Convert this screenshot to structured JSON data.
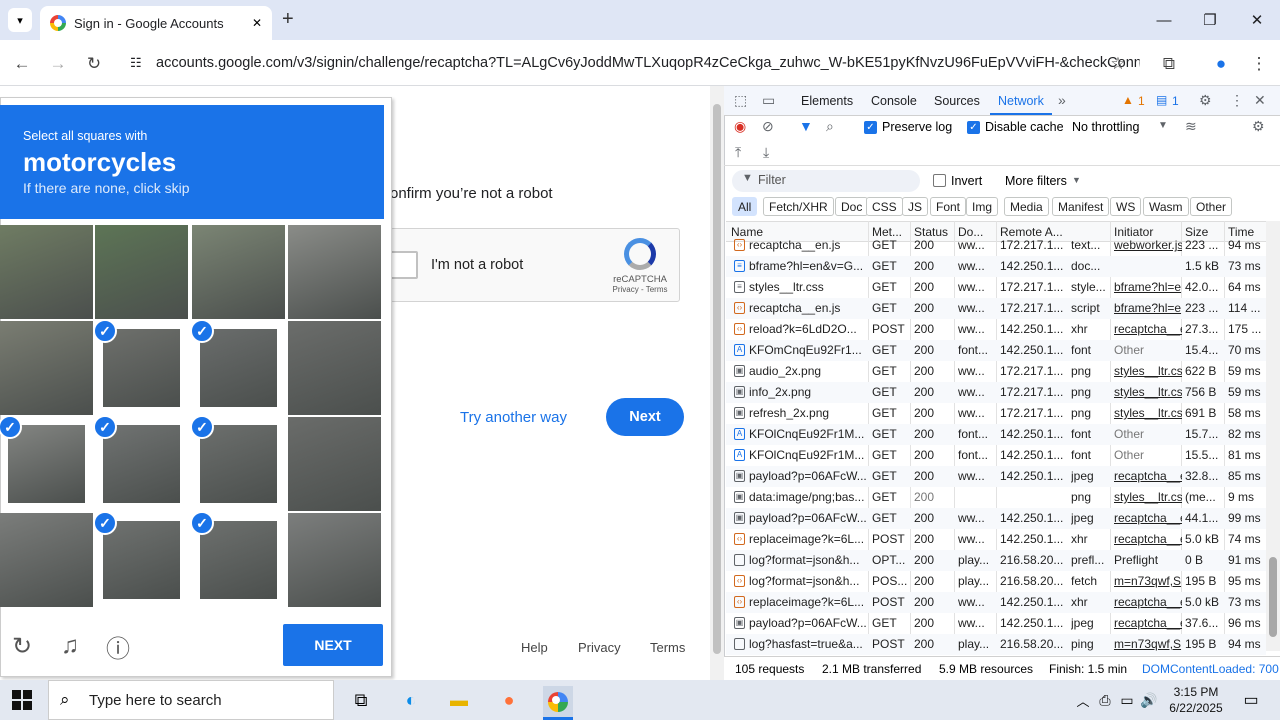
{
  "browser": {
    "tab_title": "Sign in - Google Accounts",
    "url": "accounts.google.com/v3/signin/challenge/recaptcha?TL=ALgCv6yJoddMwTLXuqopR4zCeCkga_zuhwc_W-bKE51pyKfNvzU96FuEpVVviFH-&checkConn...",
    "new_tab": "+",
    "minimize": "—",
    "restore": "❐",
    "close": "✕"
  },
  "captcha": {
    "instruction": "Select all squares with",
    "target": "motorcycles",
    "hint": "If there are none, click skip",
    "next_label": "NEXT",
    "selected_tiles": [
      5,
      6,
      8,
      9,
      10,
      13,
      14
    ]
  },
  "page": {
    "robot_text": "onfirm you’re not a robot",
    "recaptcha_label": "I'm not a robot",
    "recaptcha_brand": "reCAPTCHA",
    "recaptcha_links": "Privacy - Terms",
    "try_another": "Try another way",
    "next": "Next",
    "footer": [
      "Help",
      "Privacy",
      "Terms"
    ]
  },
  "devtools": {
    "tabs": [
      "Elements",
      "Console",
      "Sources",
      "Network"
    ],
    "active_tab": "Network",
    "warnings": "1",
    "messages": "1",
    "preserve_log": "Preserve log",
    "disable_cache": "Disable cache",
    "throttling": "No throttling",
    "filter_placeholder": "Filter",
    "invert": "Invert",
    "more_filters": "More filters",
    "type_filters": [
      "All",
      "Fetch/XHR",
      "Doc",
      "CSS",
      "JS",
      "Font",
      "Img",
      "Media",
      "Manifest",
      "WS",
      "Wasm",
      "Other"
    ],
    "columns": [
      "Name",
      "Met...",
      "Status",
      "Do...",
      "Remote A...",
      "Initiator",
      "Size",
      "Time"
    ],
    "rows": [
      {
        "name": "recaptcha__en.js",
        "method": "GET",
        "status": "200",
        "domain": "ww...",
        "remote": "172.217.1...",
        "type": "text...",
        "initiator": "webworker.js",
        "size": "223 ...",
        "time": "94 ms",
        "icon": "js"
      },
      {
        "name": "bframe?hl=en&v=G...",
        "method": "GET",
        "status": "200",
        "domain": "ww...",
        "remote": "142.250.1...",
        "type": "doc...",
        "initiator": "",
        "size": "1.5 kB",
        "time": "73 ms",
        "icon": "doc"
      },
      {
        "name": "styles__ltr.css",
        "method": "GET",
        "status": "200",
        "domain": "ww...",
        "remote": "172.217.1...",
        "type": "style...",
        "initiator": "bframe?hl=e",
        "size": "42.0...",
        "time": "64 ms",
        "icon": "css"
      },
      {
        "name": "recaptcha__en.js",
        "method": "GET",
        "status": "200",
        "domain": "ww...",
        "remote": "172.217.1...",
        "type": "script",
        "initiator": "bframe?hl=e",
        "size": "223 ...",
        "time": "114 ...",
        "icon": "js"
      },
      {
        "name": "reload?k=6LdD2O...",
        "method": "POST",
        "status": "200",
        "domain": "ww...",
        "remote": "142.250.1...",
        "type": "xhr",
        "initiator": "recaptcha__e",
        "size": "27.3...",
        "time": "175 ...",
        "icon": "js"
      },
      {
        "name": "KFOmCnqEu92Fr1...",
        "method": "GET",
        "status": "200",
        "domain": "font...",
        "remote": "142.250.1...",
        "type": "font",
        "initiator": "Other",
        "size": "15.4...",
        "time": "70 ms",
        "icon": "font"
      },
      {
        "name": "audio_2x.png",
        "method": "GET",
        "status": "200",
        "domain": "ww...",
        "remote": "172.217.1...",
        "type": "png",
        "initiator": "styles__ltr.css",
        "size": "622 B",
        "time": "59 ms",
        "icon": "img"
      },
      {
        "name": "info_2x.png",
        "method": "GET",
        "status": "200",
        "domain": "ww...",
        "remote": "172.217.1...",
        "type": "png",
        "initiator": "styles__ltr.css",
        "size": "756 B",
        "time": "59 ms",
        "icon": "img"
      },
      {
        "name": "refresh_2x.png",
        "method": "GET",
        "status": "200",
        "domain": "ww...",
        "remote": "172.217.1...",
        "type": "png",
        "initiator": "styles__ltr.css",
        "size": "691 B",
        "time": "58 ms",
        "icon": "img"
      },
      {
        "name": "KFOlCnqEu92Fr1M...",
        "method": "GET",
        "status": "200",
        "domain": "font...",
        "remote": "142.250.1...",
        "type": "font",
        "initiator": "Other",
        "size": "15.7...",
        "time": "82 ms",
        "icon": "font"
      },
      {
        "name": "KFOlCnqEu92Fr1M...",
        "method": "GET",
        "status": "200",
        "domain": "font...",
        "remote": "142.250.1...",
        "type": "font",
        "initiator": "Other",
        "size": "15.5...",
        "time": "81 ms",
        "icon": "font"
      },
      {
        "name": "payload?p=06AFcW...",
        "method": "GET",
        "status": "200",
        "domain": "ww...",
        "remote": "142.250.1...",
        "type": "jpeg",
        "initiator": "recaptcha__e",
        "size": "32.8...",
        "time": "85 ms",
        "icon": "img"
      },
      {
        "name": "data:image/png;bas...",
        "method": "GET",
        "status": "200",
        "domain": "",
        "remote": "",
        "type": "png",
        "initiator": "styles__ltr.css",
        "size": "(me...",
        "time": "9 ms",
        "icon": "img"
      },
      {
        "name": "payload?p=06AFcW...",
        "method": "GET",
        "status": "200",
        "domain": "ww...",
        "remote": "142.250.1...",
        "type": "jpeg",
        "initiator": "recaptcha__e",
        "size": "44.1...",
        "time": "99 ms",
        "icon": "img"
      },
      {
        "name": "replaceimage?k=6L...",
        "method": "POST",
        "status": "200",
        "domain": "ww...",
        "remote": "142.250.1...",
        "type": "xhr",
        "initiator": "recaptcha__e",
        "size": "5.0 kB",
        "time": "74 ms",
        "icon": "js"
      },
      {
        "name": "log?format=json&h...",
        "method": "OPT...",
        "status": "200",
        "domain": "play...",
        "remote": "216.58.20...",
        "type": "prefl...",
        "initiator": "Preflight",
        "size": "0 B",
        "time": "91 ms",
        "icon": "blank"
      },
      {
        "name": "log?format=json&h...",
        "method": "POS...",
        "status": "200",
        "domain": "play...",
        "remote": "216.58.20...",
        "type": "fetch",
        "initiator": "m=n73qwf,S",
        "size": "195 B",
        "time": "95 ms",
        "icon": "js"
      },
      {
        "name": "replaceimage?k=6L...",
        "method": "POST",
        "status": "200",
        "domain": "ww...",
        "remote": "142.250.1...",
        "type": "xhr",
        "initiator": "recaptcha__e",
        "size": "5.0 kB",
        "time": "73 ms",
        "icon": "js"
      },
      {
        "name": "payload?p=06AFcW...",
        "method": "GET",
        "status": "200",
        "domain": "ww...",
        "remote": "142.250.1...",
        "type": "jpeg",
        "initiator": "recaptcha__e",
        "size": "37.6...",
        "time": "96 ms",
        "icon": "img"
      },
      {
        "name": "log?hasfast=true&a...",
        "method": "POST",
        "status": "200",
        "domain": "play...",
        "remote": "216.58.20...",
        "type": "ping",
        "initiator": "m=n73qwf,S",
        "size": "195 B",
        "time": "94 ms",
        "icon": "blank"
      }
    ],
    "status": {
      "requests": "105 requests",
      "transferred": "2.1 MB transferred",
      "resources": "5.9 MB resources",
      "finish": "Finish: 1.5 min",
      "dcl": "DOMContentLoaded: 700"
    }
  },
  "taskbar": {
    "search": "Type here to search",
    "time": "3:15 PM",
    "date": "6/22/2025"
  }
}
